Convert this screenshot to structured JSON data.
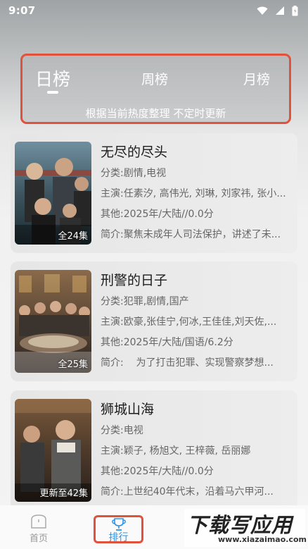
{
  "status_bar": {
    "time": "9:07"
  },
  "tabs": {
    "items": [
      {
        "label": "日榜",
        "active": true
      },
      {
        "label": "周榜",
        "active": false
      },
      {
        "label": "月榜",
        "active": false
      }
    ],
    "subtitle": "根据当前热度整理 不定时更新"
  },
  "colors": {
    "highlight_border": "#e0523c",
    "nav_active": "#2d93e8"
  },
  "shows": [
    {
      "title": "无尽的尽头",
      "episodes": "全24集",
      "genre_label": "分类:",
      "genre": "剧情,电视",
      "cast_label": "主演:",
      "cast": "任素汐, 高伟光, 刘琳, 刘家祎, 张小...",
      "other_label": "其他:",
      "other": "2025年/大陆//0.0分",
      "intro_label": "简介:",
      "intro": "聚焦未成年人司法保护，讲述了未..."
    },
    {
      "title": "刑警的日子",
      "episodes": "全25集",
      "genre_label": "分类:",
      "genre": "犯罪,剧情,国产",
      "cast_label": "主演:",
      "cast": "欧豪,张佳宁,何冰,王佳佳,刘天佐,...",
      "other_label": "其他:",
      "other": "2025年/大陆/国语/6.2分",
      "intro_label": "简介:",
      "intro": "    为了打击犯罪、实现警察梦想..."
    },
    {
      "title": "狮城山海",
      "episodes": "更新至42集",
      "genre_label": "分类:",
      "genre": "电视",
      "cast_label": "主演:",
      "cast": "颖子, 杨旭文, 王梓薇, 岳丽娜",
      "other_label": "其他:",
      "other": "2025年/大陆//0.0分",
      "intro_label": "简介:",
      "intro": "上世纪40年代末，沿着马六甲河..."
    }
  ],
  "bottom_nav": {
    "home_label": "首页",
    "rank_label": "排行"
  },
  "watermark": {
    "main": "下载写应用",
    "sub": "www.xiazaimao.com"
  }
}
